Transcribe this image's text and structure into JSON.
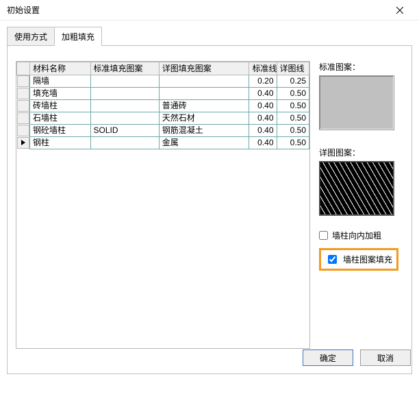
{
  "window": {
    "title": "初始设置"
  },
  "tabs": [
    {
      "label": "使用方式",
      "active": false
    },
    {
      "label": "加粗填充",
      "active": true
    }
  ],
  "table": {
    "headers": [
      "材料名称",
      "标准填充图案",
      "详图填充图案",
      "标准线",
      "详图线"
    ],
    "rows": [
      {
        "name": "隔墙",
        "std": "",
        "detail": "",
        "n1": "0.20",
        "n2": "0.25",
        "current": false
      },
      {
        "name": "填充墙",
        "std": "",
        "detail": "",
        "n1": "0.40",
        "n2": "0.50",
        "current": false
      },
      {
        "name": "砖墙柱",
        "std": "",
        "detail": "普通砖",
        "n1": "0.40",
        "n2": "0.50",
        "current": false
      },
      {
        "name": "石墙柱",
        "std": "",
        "detail": "天然石材",
        "n1": "0.40",
        "n2": "0.50",
        "current": false
      },
      {
        "name": "钢砼墙柱",
        "std": "SOLID",
        "detail": "钢筋混凝土",
        "n1": "0.40",
        "n2": "0.50",
        "current": false
      },
      {
        "name": "钢柱",
        "std": "",
        "detail": "金属",
        "n1": "0.40",
        "n2": "0.50",
        "current": true
      }
    ]
  },
  "right": {
    "std_label": "标准图案：",
    "detail_label": "详图图案：",
    "chk_inner_bold": "墙柱向内加粗",
    "chk_pattern_fill": "墙柱图案填充"
  },
  "buttons": {
    "ok": "确定",
    "cancel": "取消"
  }
}
